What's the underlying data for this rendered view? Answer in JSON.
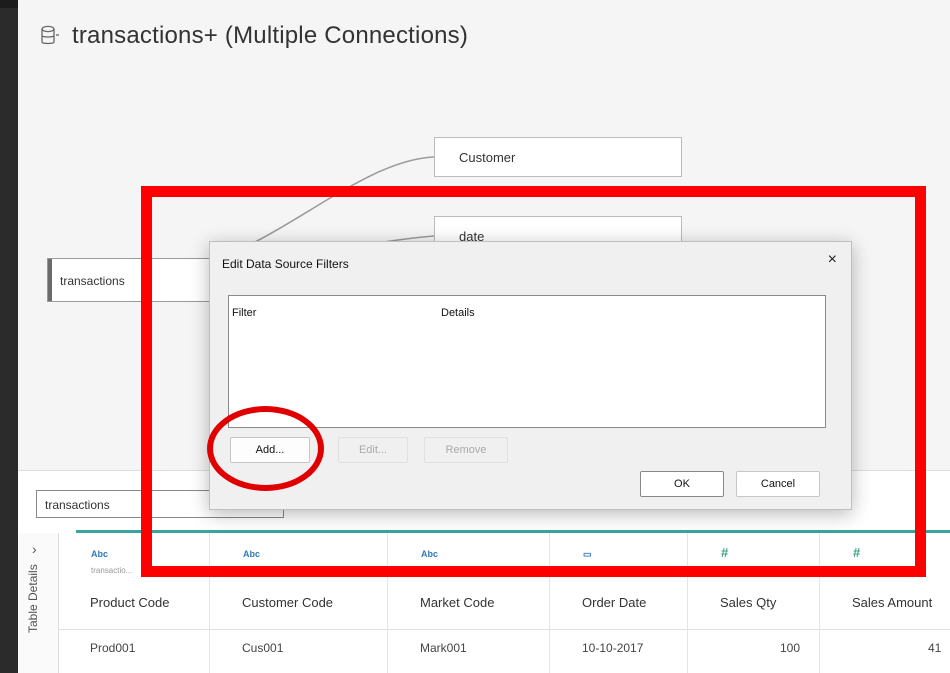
{
  "header": {
    "db_icon": "database-icon",
    "title": "transactions+ (Multiple Connections)"
  },
  "canvas": {
    "nodes": {
      "customer": "Customer",
      "date": "date",
      "transactions": "transactions"
    }
  },
  "dialog": {
    "title": "Edit Data Source Filters",
    "close_glyph": "×",
    "columns": {
      "filter": "Filter",
      "details": "Details"
    },
    "buttons": {
      "add": "Add...",
      "edit": "Edit...",
      "remove": "Remove",
      "ok": "OK",
      "cancel": "Cancel"
    }
  },
  "table_panel": {
    "selected_table": "transactions",
    "side_label": "Table Details",
    "chevron": "›",
    "columns": [
      {
        "type_icon": "Abc",
        "type_kind": "text-type-icon",
        "source": "transactio...",
        "header": "Product Code",
        "value": "Prod001"
      },
      {
        "type_icon": "Abc",
        "type_kind": "text-type-icon",
        "source": "",
        "header": "Customer Code",
        "value": "Cus001"
      },
      {
        "type_icon": "Abc",
        "type_kind": "text-type-icon",
        "source": "",
        "header": "Market Code",
        "value": "Mark001"
      },
      {
        "type_icon": "▭",
        "type_kind": "date-type-icon",
        "source": "",
        "header": "Order Date",
        "value": "10-10-2017"
      },
      {
        "type_icon": "#",
        "type_kind": "number-type-icon",
        "source": "",
        "header": "Sales Qty",
        "value": "100"
      },
      {
        "type_icon": "#",
        "type_kind": "number-type-icon",
        "source": "",
        "header": "Sales Amount",
        "value": "41"
      }
    ]
  },
  "annotation_colors": {
    "highlight": "#ff0000"
  }
}
